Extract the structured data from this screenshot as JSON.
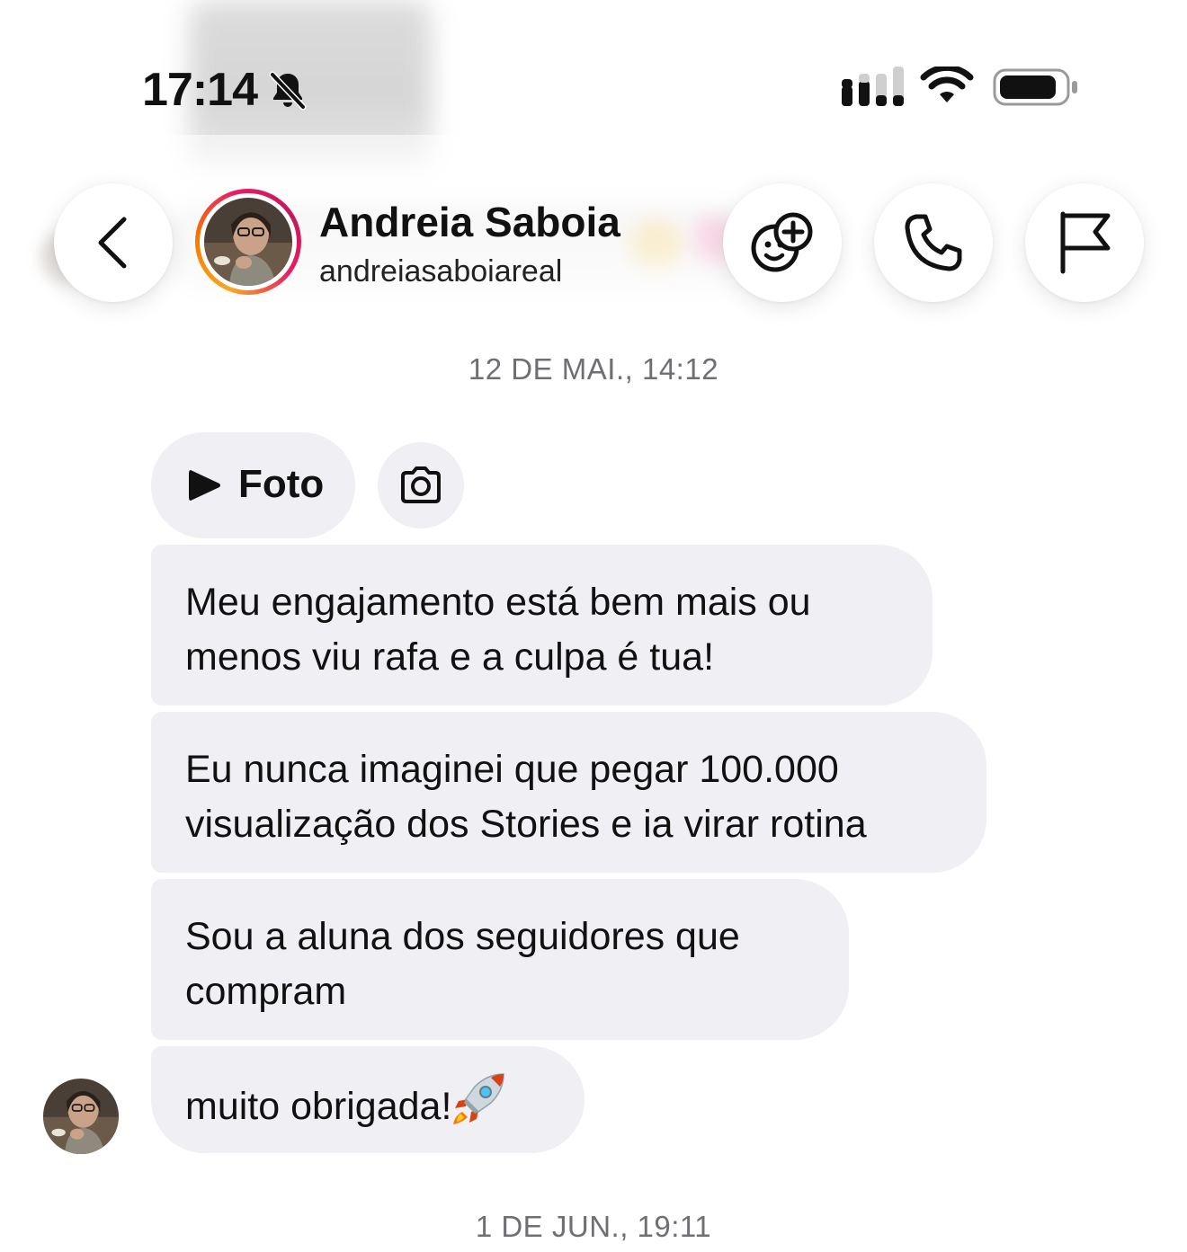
{
  "status_bar": {
    "time": "17:14",
    "icons": [
      "bell-slash-icon",
      "cellular-signal-icon",
      "wifi-icon",
      "battery-icon"
    ]
  },
  "header": {
    "contact_name": "Andreia Saboia",
    "username": "andreiasaboiareal",
    "buttons": [
      "back-chevron-icon",
      "effects-icon",
      "phone-icon",
      "flag-icon"
    ]
  },
  "conversation": {
    "timestamp_1": "12 DE MAI., 14:12",
    "reply_chip": {
      "label": "Foto",
      "icon": "play-icon",
      "secondary_icon": "camera-icon"
    },
    "messages": [
      {
        "lines": [
          "Meu engajamento está bem mais ou",
          "menos viu rafa e a culpa é tua!"
        ]
      },
      {
        "lines": [
          "Eu nunca imaginei que pegar 100.000",
          "visualização dos Stories e ia virar rotina"
        ]
      },
      {
        "lines": [
          "Sou a aluna dos seguidores que",
          "compram"
        ]
      },
      {
        "lines": [
          "muito obrigada!"
        ],
        "emoji": "rocket-emoji"
      }
    ],
    "timestamp_2": "1 DE JUN., 19:11"
  },
  "colors": {
    "bubble": "#efeff4",
    "timestamp": "#6f6f73",
    "story_ring_start": "#f9a825",
    "story_ring_end": "#e91e63"
  }
}
